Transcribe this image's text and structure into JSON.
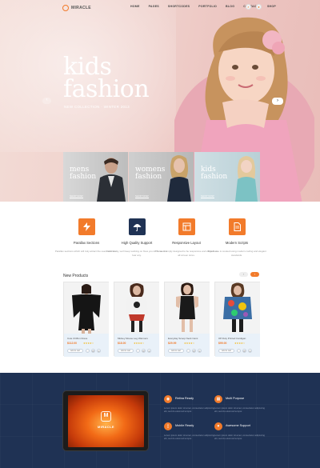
{
  "brand": {
    "name": "MIRACLE",
    "accent": "#f27b2b",
    "navy": "#1f3254"
  },
  "nav": {
    "items": [
      "HOME",
      "PAGES",
      "SHORTCODES",
      "PORTFOLIO",
      "BLOG",
      "CONTACT",
      "SHOP"
    ]
  },
  "hero": {
    "title_line1": "kids",
    "title_line2": "fashion",
    "subtitle": "NEW COLLECTION · WINTER 2013"
  },
  "categories": [
    {
      "line1": "mens",
      "line2": "fashion",
      "cta": "SHOP NOW"
    },
    {
      "line1": "womens",
      "line2": "fashion",
      "cta": "SHOP NOW"
    },
    {
      "line1": "kids",
      "line2": "fashion",
      "cta": "SHOP NOW"
    }
  ],
  "features": [
    {
      "title": "Parallax Sections",
      "icon": "lightning-icon",
      "color": "#f27b2b",
      "desc": "Parallax sections which will truly attract the users attention."
    },
    {
      "title": "High Quality Support",
      "icon": "umbrella-icon",
      "color": "#1f3254",
      "desc": "Don't worry, we'll keep working on fixes you don't need to fear any."
    },
    {
      "title": "Responsive Layout",
      "icon": "layout-icon",
      "color": "#f27b2b",
      "desc": "Theme is simply designed to be responsive and elegant on all screen sizes."
    },
    {
      "title": "Modern Scripts",
      "icon": "document-icon",
      "color": "#f27b2b",
      "desc": "This theme is cooked using modern coding and elegant standards."
    }
  ],
  "products": {
    "heading": "New Products",
    "add_to_cart": "Add to cart",
    "items": [
      {
        "name": "Cote Chiffon Dress",
        "price": "$112.00",
        "stars": "★★★★☆"
      },
      {
        "name": "Mickey Mouse Leg Warmers",
        "price": "$18.00",
        "stars": "★★★★☆"
      },
      {
        "name": "Everyday Scoop Neck Cami",
        "price": "$29.99",
        "stars": "★★★★☆"
      },
      {
        "name": "Off Duty Printed Cardigan",
        "price": "$99.00",
        "stars": "★★★★☆"
      }
    ]
  },
  "promo": {
    "tablet_brand": "MIRACLE",
    "features": [
      {
        "title": "Retina Ready",
        "icon": "eye-icon",
        "desc": "Lorem ipsum dolor sit amet, consectetur adipiscing elit, sed do eiusmod tempor."
      },
      {
        "title": "Multi Purpose",
        "icon": "grid-icon",
        "desc": "Lorem ipsum dolor sit amet, consectetur adipiscing elit, sed do eiusmod tempor."
      },
      {
        "title": "Mobile Ready",
        "icon": "mobile-icon",
        "desc": "Lorem ipsum dolor sit amet, consectetur adipiscing elit, sed do eiusmod tempor."
      },
      {
        "title": "Awesome Support",
        "icon": "heart-icon",
        "desc": "Lorem ipsum dolor sit amet, consectetur adipiscing elit, sed do eiusmod tempor."
      }
    ]
  }
}
